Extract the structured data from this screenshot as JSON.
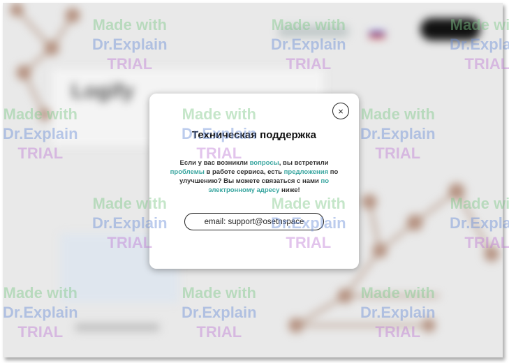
{
  "modal": {
    "close_glyph": "×",
    "title": "Техническая поддержка",
    "body_parts": [
      {
        "text": "Если у вас возникли ",
        "highlight": false
      },
      {
        "text": "вопросы",
        "highlight": true
      },
      {
        "text": ", вы встретили ",
        "highlight": false
      },
      {
        "text": "проблемы",
        "highlight": true
      },
      {
        "text": " в работе сервиса, есть ",
        "highlight": false
      },
      {
        "text": "предложения",
        "highlight": true
      },
      {
        "text": " по улучшению? Вы можете связаться с нами ",
        "highlight": false
      },
      {
        "text": "по электронному адресу",
        "highlight": true
      },
      {
        "text": " ниже!",
        "highlight": false
      }
    ],
    "email_text": "email: support@osetnspace"
  },
  "background": {
    "logo_text": "Logify"
  },
  "watermark": {
    "line1": "Made with",
    "line2": "Dr.Explain",
    "line3": "TRIAL"
  },
  "colors": {
    "highlight": "#3aa6a0",
    "dim_overlay": "#e9e9e9"
  }
}
